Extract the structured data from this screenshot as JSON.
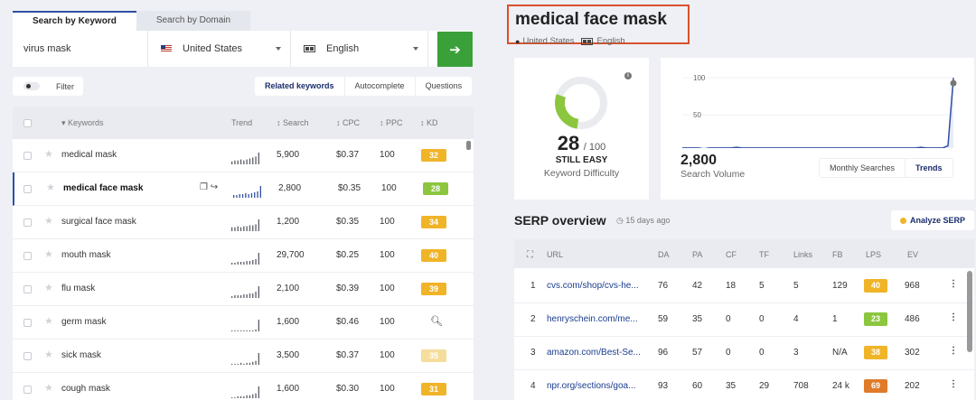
{
  "search_tabs": [
    "Search by Keyword",
    "Search by Domain"
  ],
  "search": {
    "keyword_value": "virus mask",
    "country": "United States",
    "language": "English",
    "go_icon": "arrow-right-icon"
  },
  "filter_label": "Filter",
  "view_tabs": [
    "Related keywords",
    "Autocomplete",
    "Questions"
  ],
  "table": {
    "columns": [
      "Keywords",
      "Trend",
      "Search",
      "CPC",
      "PPC",
      "KD"
    ],
    "rows": [
      {
        "keyword": "medical mask",
        "search": "5,900",
        "cpc": "$0.37",
        "ppc": "100",
        "kd": "32",
        "kd_color": "#f0b429",
        "trend": [
          3,
          4,
          4,
          5,
          4,
          5,
          6,
          7,
          8,
          12
        ]
      },
      {
        "keyword": "medical face mask",
        "search": "2,800",
        "cpc": "$0.35",
        "ppc": "100",
        "kd": "28",
        "kd_color": "#8cc63f",
        "selected": true,
        "trend": [
          3,
          3,
          4,
          4,
          5,
          4,
          5,
          6,
          7,
          13
        ],
        "trend_color": "#2f4fa3"
      },
      {
        "keyword": "surgical face mask",
        "search": "1,200",
        "cpc": "$0.35",
        "ppc": "100",
        "kd": "34",
        "kd_color": "#f0b429",
        "trend": [
          4,
          4,
          5,
          4,
          5,
          5,
          6,
          6,
          7,
          12
        ]
      },
      {
        "keyword": "mouth mask",
        "search": "29,700",
        "cpc": "$0.25",
        "ppc": "100",
        "kd": "40",
        "kd_color": "#f0b429",
        "trend": [
          2,
          2,
          3,
          3,
          3,
          4,
          4,
          5,
          6,
          13
        ]
      },
      {
        "keyword": "flu mask",
        "search": "2,100",
        "cpc": "$0.39",
        "ppc": "100",
        "kd": "39",
        "kd_color": "#f0b429",
        "trend": [
          2,
          3,
          3,
          3,
          4,
          4,
          5,
          5,
          7,
          13
        ]
      },
      {
        "keyword": "germ mask",
        "search": "1,600",
        "cpc": "$0.46",
        "ppc": "100",
        "kd": "",
        "kd_icon": "search-icon",
        "trend": [
          1,
          1,
          1,
          1,
          1,
          1,
          1,
          1,
          2,
          12
        ]
      },
      {
        "keyword": "sick mask",
        "search": "3,500",
        "cpc": "$0.37",
        "ppc": "100",
        "kd": "35",
        "kd_color": "#f5dd9c",
        "trend": [
          1,
          1,
          1,
          2,
          1,
          2,
          2,
          3,
          4,
          12
        ]
      },
      {
        "keyword": "cough mask",
        "search": "1,600",
        "cpc": "$0.30",
        "ppc": "100",
        "kd": "31",
        "kd_color": "#f0b429",
        "trend": [
          1,
          1,
          2,
          2,
          2,
          3,
          3,
          4,
          5,
          12
        ]
      }
    ]
  },
  "overview": {
    "keyword": "medical face mask",
    "location": "United States",
    "language": "English"
  },
  "difficulty": {
    "score": "28",
    "max": "/ 100",
    "status": "STILL EASY",
    "label": "Keyword Difficulty",
    "value_pct": 28,
    "color": "#8cc63f"
  },
  "volume": {
    "value": "2,800",
    "label": "Search Volume",
    "tabs": [
      "Monthly Searches",
      "Trends"
    ],
    "chart_data": {
      "type": "line",
      "y_ticks": [
        100,
        50
      ],
      "ylim": [
        0,
        110
      ],
      "values": [
        5,
        5,
        5,
        5,
        4,
        5,
        5,
        5,
        5,
        5,
        6,
        5,
        5,
        5,
        5,
        5,
        5,
        5,
        5,
        5,
        5,
        5,
        5,
        5,
        5,
        5,
        5,
        5,
        5,
        5,
        5,
        5,
        5,
        5,
        5,
        5,
        5,
        5,
        5,
        5,
        5,
        5,
        5,
        5,
        6,
        5,
        5,
        5,
        5,
        8,
        100
      ],
      "color": "#2f4fa3"
    }
  },
  "serp": {
    "title": "SERP overview",
    "age": "15 days ago",
    "analyze_label": "Analyze SERP",
    "columns": [
      "URL",
      "DA",
      "PA",
      "CF",
      "TF",
      "Links",
      "FB",
      "LPS",
      "EV"
    ],
    "rows": [
      {
        "rank": "1",
        "domain": "cvs.com",
        "path": "/shop/cvs-he...",
        "da": "76",
        "pa": "42",
        "cf": "18",
        "tf": "5",
        "links": "5",
        "fb": "129",
        "lps": "40",
        "lps_color": "#f0b429",
        "ev": "968"
      },
      {
        "rank": "2",
        "domain": "henryschein.com",
        "path": "/me...",
        "da": "59",
        "pa": "35",
        "cf": "0",
        "tf": "0",
        "links": "4",
        "fb": "1",
        "lps": "23",
        "lps_color": "#8cc63f",
        "ev": "486"
      },
      {
        "rank": "3",
        "domain": "amazon.com",
        "path": "/Best-Se...",
        "da": "96",
        "pa": "57",
        "cf": "0",
        "tf": "0",
        "links": "3",
        "fb": "N/A",
        "lps": "38",
        "lps_color": "#f0b429",
        "ev": "302"
      },
      {
        "rank": "4",
        "domain": "npr.org",
        "path": "/sections/goa...",
        "da": "93",
        "pa": "60",
        "cf": "35",
        "tf": "29",
        "links": "708",
        "fb": "24 k",
        "lps": "69",
        "lps_color": "#e07b2a",
        "ev": "202"
      }
    ]
  }
}
